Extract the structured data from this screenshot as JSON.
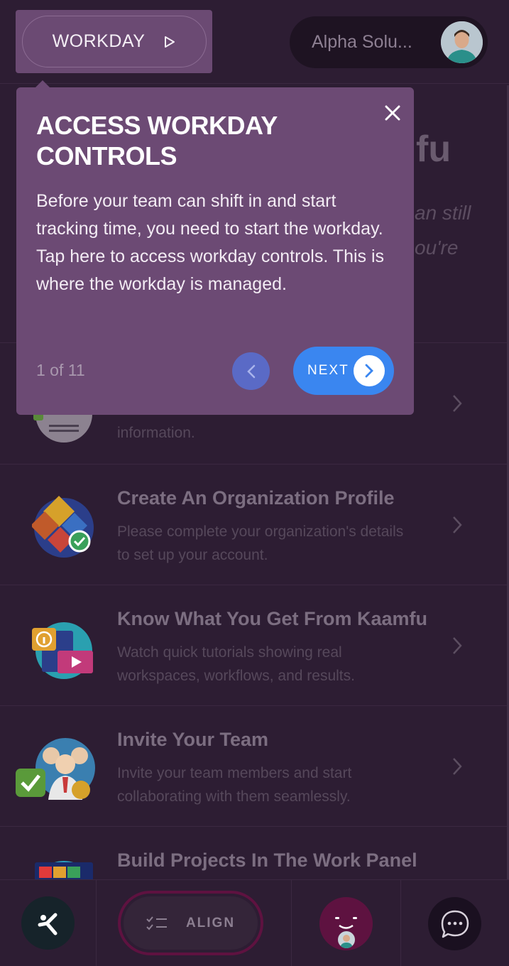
{
  "header": {
    "workday_label": "WORKDAY",
    "org_name": "Alpha Solu..."
  },
  "hero": {
    "title_fragment": "fu",
    "subtitle_line1_fragment": "an still",
    "subtitle_line2_fragment": "ou're"
  },
  "tooltip": {
    "title": "ACCESS WORKDAY CONTROLS",
    "body": "Before your team can shift in and start tracking time, you need to start the workday. Tap here to access workday controls. This is where the workday is managed.",
    "step": "1 of 11",
    "next_label": "NEXT"
  },
  "tasks": [
    {
      "title": "",
      "desc": "information.",
      "icon": "user-profile-icon"
    },
    {
      "title": "Create An Organization Profile",
      "desc": "Please complete your organization's details to set up your account.",
      "icon": "organization-icon"
    },
    {
      "title": "Know What You Get From Kaamfu",
      "desc": "Watch quick tutorials showing real workspaces, workflows, and results.",
      "icon": "tutorials-icon"
    },
    {
      "title": "Invite Your Team",
      "desc": "Invite your team members and start collaborating with them seamlessly.",
      "icon": "team-invite-icon"
    },
    {
      "title": "Build Projects In The Work Panel",
      "desc": "",
      "icon": "work-panel-icon"
    }
  ],
  "bottom_nav": {
    "align_label": "ALIGN"
  },
  "colors": {
    "background": "#2d1d33",
    "tooltip": "#6c4a74",
    "next_button": "#3a86f0",
    "prev_button": "#5a6ac6",
    "align_ring": "#5e1240"
  }
}
